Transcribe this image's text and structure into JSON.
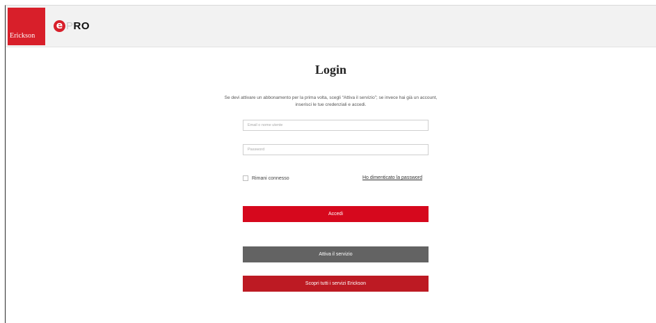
{
  "header": {
    "brand_name": "Erickson",
    "product_logo": {
      "e_letter": "e",
      "p_letter": "P",
      "ro_letters": "RO"
    }
  },
  "login": {
    "title": "Login",
    "intro_line1": "Se devi attivare un abbonamento per la prima volta, scegli “Attiva il servizio”; se invece hai già un account,",
    "intro_line2": "inserisci le tue credenziali e accedi.",
    "email_placeholder": "Email o nome utente",
    "email_value": "",
    "password_placeholder": "Password",
    "password_value": "",
    "remember_label": "Rimani connesso",
    "remember_checked": false,
    "forgot_label": "Ho dimenticato la password",
    "submit_label": "Accedi"
  },
  "actions": {
    "activate_label": "Attiva il servizio",
    "discover_label": "Scopri tutti i servizi Erickson"
  },
  "colors": {
    "brand_red": "#d81f2a",
    "submit_red": "#d6081d",
    "activate_gray": "#636363",
    "discover_red": "#bd1a23",
    "header_bg": "#f2f2f2"
  }
}
